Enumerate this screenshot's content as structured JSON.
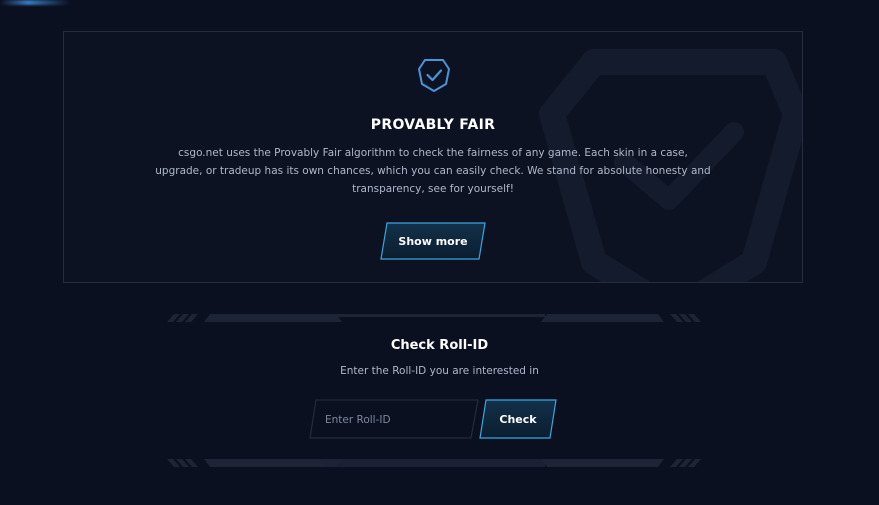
{
  "provably_fair": {
    "title": "PROVABLY FAIR",
    "description": "csgo.net uses the Provably Fair algorithm to check the fairness of any game. Each skin in a case, upgrade, or tradeup has its own chances, which you can easily check. We stand for absolute honesty and transparency, see for yourself!",
    "show_more_label": "Show more",
    "icon": "shield-check-icon"
  },
  "roll_id": {
    "title": "Check Roll-ID",
    "subtitle": "Enter the Roll-ID you are interested in",
    "input_placeholder": "Enter Roll-ID",
    "input_value": "",
    "check_label": "Check"
  },
  "colors": {
    "background": "#0b1020",
    "accent": "#3aa8e0",
    "button_fill": "#0f2a40",
    "muted_text": "#aeb7ca"
  }
}
